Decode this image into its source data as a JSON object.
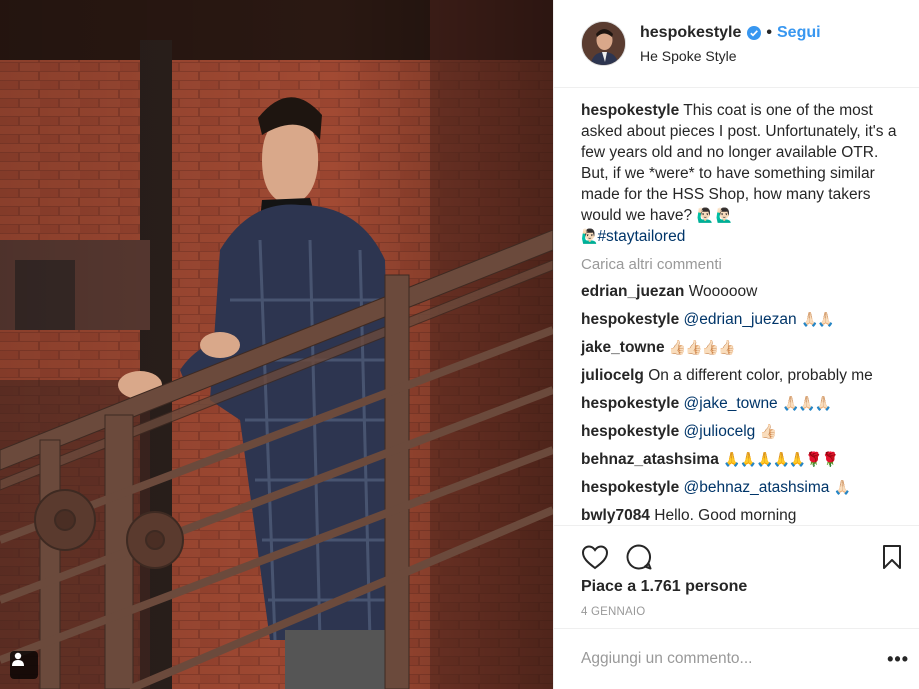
{
  "header": {
    "username": "hespokestyle",
    "separator": "•",
    "follow_label": "Segui",
    "full_name": "He Spoke Style"
  },
  "caption": {
    "username": "hespokestyle",
    "text": "This coat is one of the most asked about pieces I post. Unfortunately, it's a few years old and no longer available OTR. But, if we *were* to have something similar made for the HSS Shop, how many takers would we have?",
    "emojis": "🙋🏻‍♂️ 🙋🏻‍♂️",
    "emoji2": "🙋🏻‍♂️",
    "hashtag": "#staytailored"
  },
  "load_more": "Carica altri commenti",
  "comments": [
    {
      "user": "edrian_juezan",
      "mention": "",
      "text": "Wooooow",
      "emoji": ""
    },
    {
      "user": "hespokestyle",
      "mention": "@edrian_juezan",
      "text": "",
      "emoji": "🙏🏻🙏🏻"
    },
    {
      "user": "jake_towne",
      "mention": "",
      "text": "",
      "emoji": "👍🏻👍🏻👍🏻👍🏻"
    },
    {
      "user": "juliocelg",
      "mention": "",
      "text": "On a different color, probably me",
      "emoji": ""
    },
    {
      "user": "hespokestyle",
      "mention": "@jake_towne",
      "text": "",
      "emoji": "🙏🏻🙏🏻🙏🏻"
    },
    {
      "user": "hespokestyle",
      "mention": "@juliocelg",
      "text": "",
      "emoji": "👍🏻"
    },
    {
      "user": "behnaz_atashsima",
      "mention": "",
      "text": "",
      "emoji": "🙏🙏🙏🙏🙏🌹🌹"
    },
    {
      "user": "hespokestyle",
      "mention": "@behnaz_atashsima",
      "text": "",
      "emoji": "🙏🏻"
    },
    {
      "user": "bwly7084",
      "mention": "",
      "text": "Hello. Good morning",
      "emoji": ""
    }
  ],
  "likes_text": "Piace a 1.761 persone",
  "date_text": "4 GENNAIO",
  "add_comment_placeholder": "Aggiungi un commento...",
  "more_label": "•••",
  "icons": {
    "like": "heart-icon",
    "comment": "comment-icon",
    "save": "bookmark-icon",
    "verified": "verified-badge-icon",
    "user_tag": "user-tag-icon"
  },
  "colors": {
    "follow": "#3897f0",
    "verified": "#3897f0",
    "mention": "#003569",
    "muted": "#999999"
  }
}
